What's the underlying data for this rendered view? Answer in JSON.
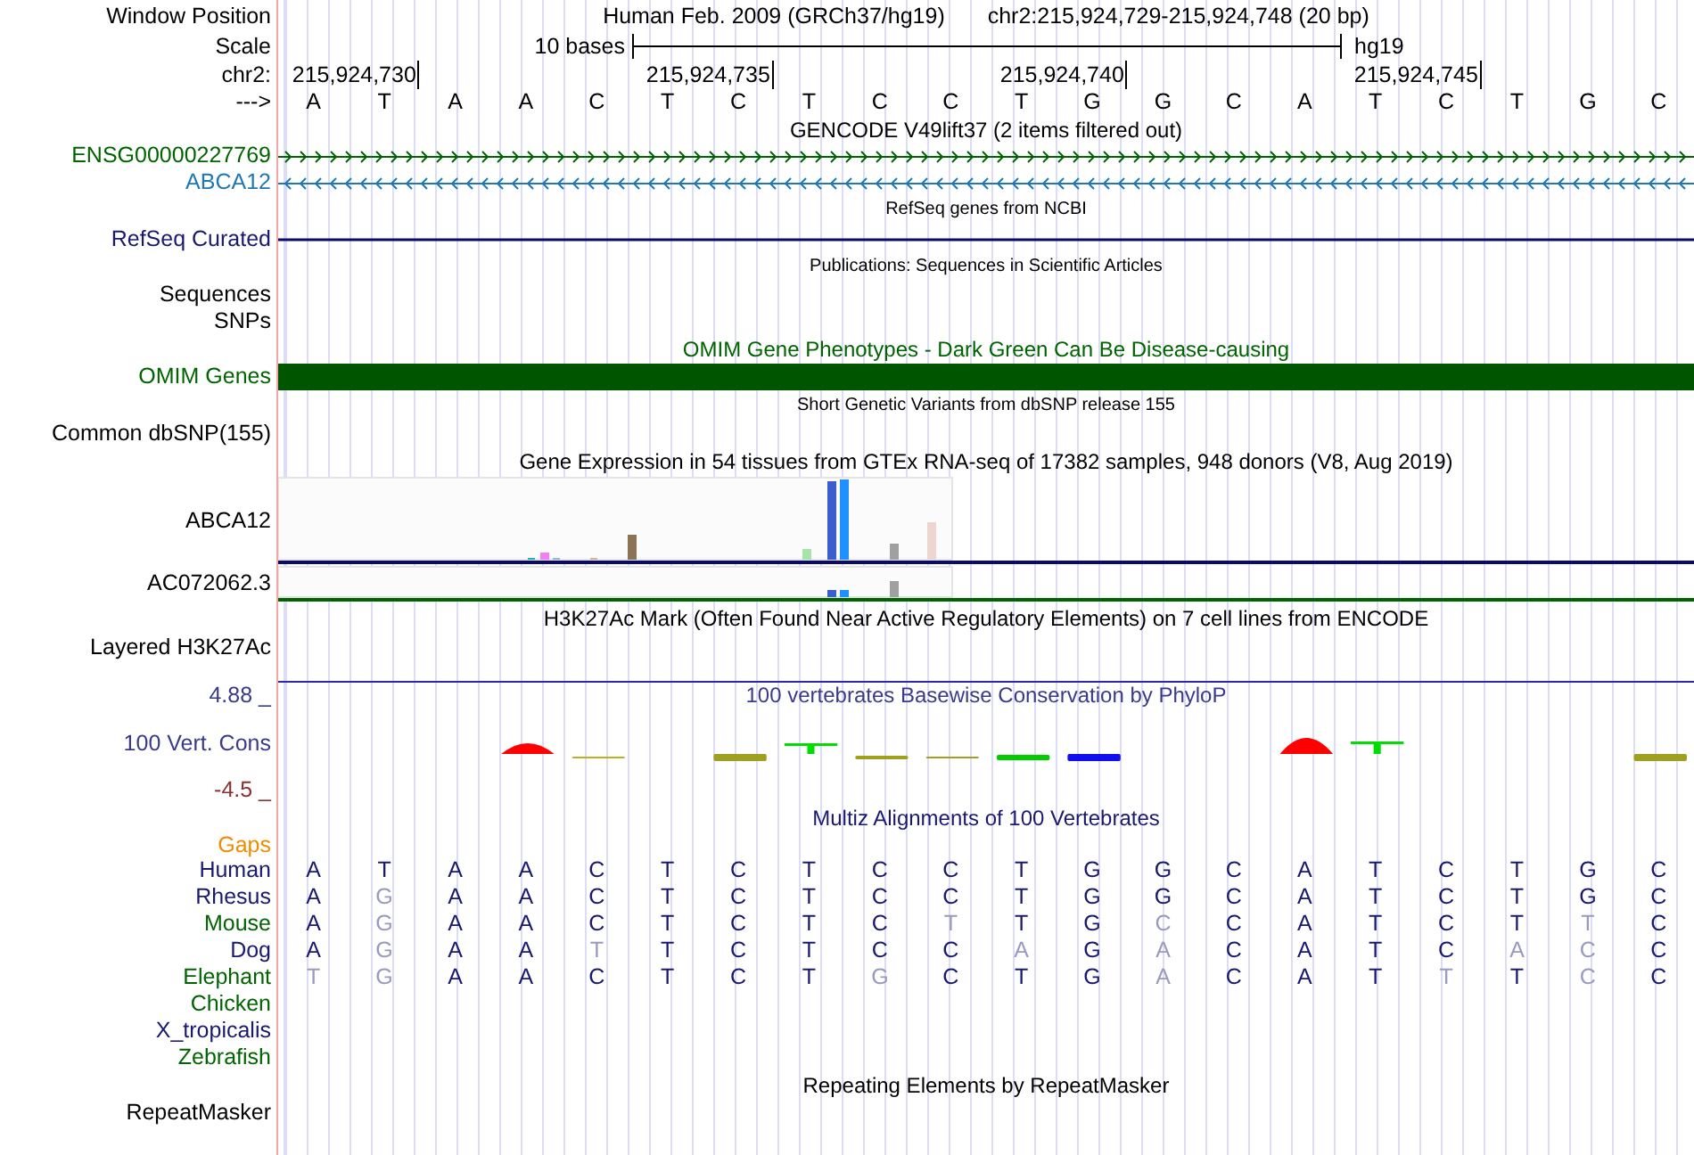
{
  "header": {
    "label": "Window Position",
    "assembly": "Human Feb. 2009 (GRCh37/hg19)",
    "position": "chr2:215,924,729-215,924,748 (20 bp)"
  },
  "scale": {
    "label": "Scale",
    "length": "10 bases",
    "assembly": "hg19"
  },
  "ruler": {
    "label": "chr2:",
    "ticks": [
      "215,924,730",
      "215,924,735",
      "215,924,740",
      "215,924,745"
    ]
  },
  "sequence": {
    "label": "--->",
    "bases": [
      "A",
      "T",
      "A",
      "A",
      "C",
      "T",
      "C",
      "T",
      "C",
      "C",
      "T",
      "G",
      "G",
      "C",
      "A",
      "T",
      "C",
      "T",
      "G",
      "C"
    ]
  },
  "gencode": {
    "title": "GENCODE V49lift37 (2 items filtered out)",
    "genes": [
      {
        "name": "ENSG00000227769",
        "color": "#006400",
        "kind": "forward"
      },
      {
        "name": "ABCA12",
        "color": "#1f77b4",
        "kind": "reverse"
      }
    ]
  },
  "refseq": {
    "title": "RefSeq genes from NCBI",
    "label": "RefSeq Curated"
  },
  "publications": {
    "title": "Publications: Sequences in Scientific Articles",
    "labels": [
      "Sequences",
      "SNPs"
    ]
  },
  "omim": {
    "title": "OMIM Gene Phenotypes - Dark Green Can Be Disease-causing",
    "label": "OMIM Genes"
  },
  "dbsnp": {
    "title": "Short Genetic Variants from dbSNP release 155",
    "label": "Common dbSNP(155)"
  },
  "gtex": {
    "title": "Gene Expression in 54 tissues from GTEx RNA-seq of 17382 samples, 948 donors (V8, Aug 2019)",
    "genes": [
      "ABCA12",
      "AC072062.3"
    ]
  },
  "h3k27ac": {
    "title": "H3K27Ac Mark (Often Found Near Active Regulatory Elements) on 7 cell lines from ENCODE",
    "label": "Layered H3K27Ac"
  },
  "phylop": {
    "title": "100 vertebrates Basewise Conservation by PhyloP",
    "label": "100 Vert. Cons",
    "max": "4.88 _",
    "min": "-4.5 _"
  },
  "multiz": {
    "title": "Multiz Alignments of 100 Vertebrates",
    "gaps_label": "Gaps",
    "species": [
      {
        "name": "Human",
        "color": "#191970",
        "bases": [
          "A",
          "T",
          "A",
          "A",
          "C",
          "T",
          "C",
          "T",
          "C",
          "C",
          "T",
          "G",
          "G",
          "C",
          "A",
          "T",
          "C",
          "T",
          "G",
          "C"
        ]
      },
      {
        "name": "Rhesus",
        "color": "#191970",
        "bases": [
          "A",
          "G",
          "A",
          "A",
          "C",
          "T",
          "C",
          "T",
          "C",
          "C",
          "T",
          "G",
          "G",
          "C",
          "A",
          "T",
          "C",
          "T",
          "G",
          "C"
        ]
      },
      {
        "name": "Mouse",
        "color": "#006400",
        "bases": [
          "A",
          "G",
          "A",
          "A",
          "C",
          "T",
          "C",
          "T",
          "C",
          "T",
          "T",
          "G",
          "C",
          "C",
          "A",
          "T",
          "C",
          "T",
          "T",
          "C"
        ]
      },
      {
        "name": "Dog",
        "color": "#191970",
        "bases": [
          "A",
          "G",
          "A",
          "A",
          "T",
          "T",
          "C",
          "T",
          "C",
          "C",
          "A",
          "G",
          "A",
          "C",
          "A",
          "T",
          "C",
          "A",
          "C",
          "C"
        ]
      },
      {
        "name": "Elephant",
        "color": "#006400",
        "bases": [
          "T",
          "G",
          "A",
          "A",
          "C",
          "T",
          "C",
          "T",
          "G",
          "C",
          "T",
          "G",
          "A",
          "C",
          "A",
          "T",
          "T",
          "T",
          "C",
          "C"
        ]
      },
      {
        "name": "Chicken",
        "color": "#006400"
      },
      {
        "name": "X_tropicalis",
        "color": "#191970"
      },
      {
        "name": "Zebrafish",
        "color": "#006400"
      }
    ]
  },
  "repeatmasker": {
    "title": "Repeating Elements by RepeatMasker",
    "label": "RepeatMasker"
  }
}
